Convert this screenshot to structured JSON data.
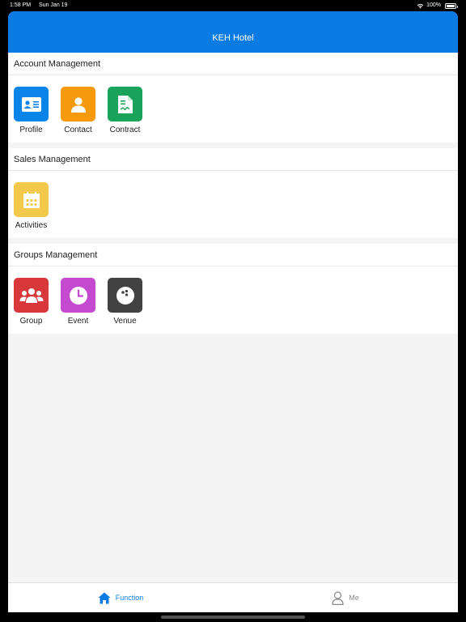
{
  "status": {
    "time": "1:58 PM",
    "date": "Sun Jan 19",
    "battery": "100%"
  },
  "header": {
    "title": "KEH Hotel"
  },
  "sections": [
    {
      "title": "Account Management",
      "items": [
        {
          "label": "Profile",
          "icon": "id-card-icon",
          "color": "#0a84e8"
        },
        {
          "label": "Contact",
          "icon": "person-icon",
          "color": "#f59a0c"
        },
        {
          "label": "Contract",
          "icon": "document-icon",
          "color": "#1aa35a"
        }
      ]
    },
    {
      "title": "Sales Management",
      "items": [
        {
          "label": "Activities",
          "icon": "calendar-icon",
          "color": "#f2c94a"
        }
      ]
    },
    {
      "title": "Groups Management",
      "items": [
        {
          "label": "Group",
          "icon": "people-icon",
          "color": "#d8383a"
        },
        {
          "label": "Event",
          "icon": "clock-icon",
          "color": "#c44bd0"
        },
        {
          "label": "Venue",
          "icon": "bowling-ball-icon",
          "color": "#424242"
        }
      ]
    }
  ],
  "tabbar": {
    "function": {
      "label": "Function",
      "icon": "home-icon",
      "color": "#0a7be3"
    },
    "me": {
      "label": "Me",
      "icon": "user-outline-icon",
      "color": "#888888"
    }
  }
}
